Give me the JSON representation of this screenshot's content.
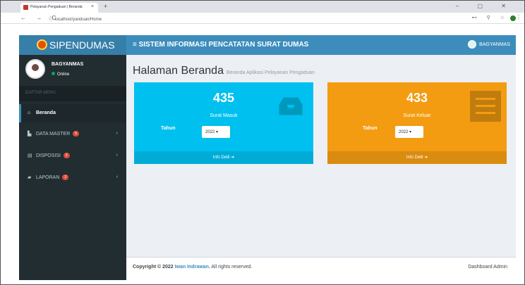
{
  "browser": {
    "tab_title": "Pelayanan Pengaduan | Beranda",
    "tab_close": "×",
    "new_tab": "+",
    "url": "localhost/yanduan/Home",
    "nav": "← → C",
    "url_icons": "⊷ ⚲ ☆",
    "profile_initial": "B"
  },
  "app": {
    "logo_text": "SIPENDUMAS",
    "header_title": "≡ SISTEM INFORMASI PENCATATAN SURAT DUMAS",
    "header_user": "BAGYANMAS"
  },
  "user_panel": {
    "name": "BAGYANMAS",
    "status": "Online"
  },
  "menu": {
    "header": "DAFTAR MENU",
    "items": [
      {
        "label": "Beranda",
        "icon": "home-icon",
        "badge": ""
      },
      {
        "label": "DATA MASTER",
        "icon": "file-icon",
        "badge": "5"
      },
      {
        "label": "DISPOSISI",
        "icon": "list-icon",
        "badge": "2"
      },
      {
        "label": "LAPORAN",
        "icon": "book-icon",
        "badge": "2"
      }
    ]
  },
  "page": {
    "title": "Halaman Beranda",
    "subtitle": "Beranda Aplikasi Pelayanan Pengaduan"
  },
  "boxes": [
    {
      "count": "435",
      "label": "Surat Masuk",
      "tahun_label": "Tahun",
      "year": "2022 ▾",
      "footer": "Info Detil ➜",
      "color": "#00c0ef"
    },
    {
      "count": "433",
      "label": "Surat Keluar",
      "tahun_label": "Tahun",
      "year": "2022 ▾",
      "footer": "Info Detil ➜",
      "color": "#f39c12"
    }
  ],
  "footer": {
    "copyright": "Copyright © 2022",
    "author": "Iwan Indrawan.",
    "rights": "All rights reserved.",
    "right_text": "Dashboard Admin"
  }
}
